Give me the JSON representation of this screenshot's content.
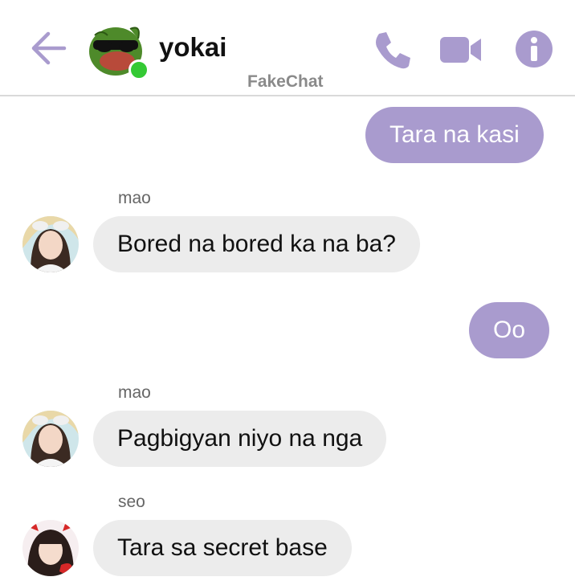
{
  "header": {
    "contact_name": "yokai",
    "watermark": "FakeChat",
    "accent_color": "#a99bce",
    "online_color": "#34c934",
    "icons": [
      "back-arrow-icon",
      "phone-icon",
      "video-camera-icon",
      "info-icon"
    ]
  },
  "messages": [
    {
      "direction": "outgoing",
      "text": "Tara na kasi"
    },
    {
      "direction": "incoming",
      "sender": "mao",
      "text": "Bored na bored ka na ba?"
    },
    {
      "direction": "outgoing",
      "text": "Oo"
    },
    {
      "direction": "incoming",
      "sender": "mao",
      "text": "Pagbigyan niyo na nga"
    },
    {
      "direction": "incoming",
      "sender": "seo",
      "text": "Tara sa secret base"
    }
  ]
}
